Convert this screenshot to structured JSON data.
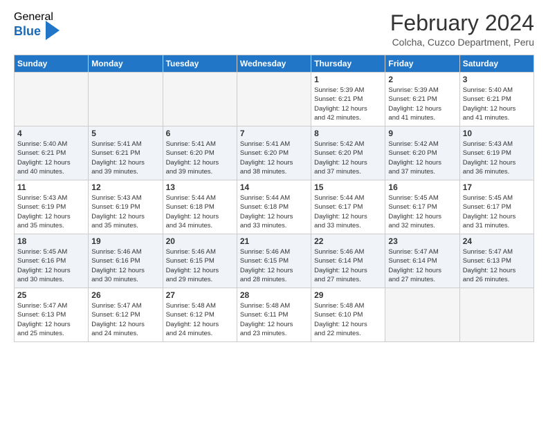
{
  "logo": {
    "general": "General",
    "blue": "Blue"
  },
  "title": "February 2024",
  "subtitle": "Colcha, Cuzco Department, Peru",
  "days_of_week": [
    "Sunday",
    "Monday",
    "Tuesday",
    "Wednesday",
    "Thursday",
    "Friday",
    "Saturday"
  ],
  "weeks": [
    [
      {
        "day": "",
        "info": ""
      },
      {
        "day": "",
        "info": ""
      },
      {
        "day": "",
        "info": ""
      },
      {
        "day": "",
        "info": ""
      },
      {
        "day": "1",
        "info": "Sunrise: 5:39 AM\nSunset: 6:21 PM\nDaylight: 12 hours\nand 42 minutes."
      },
      {
        "day": "2",
        "info": "Sunrise: 5:39 AM\nSunset: 6:21 PM\nDaylight: 12 hours\nand 41 minutes."
      },
      {
        "day": "3",
        "info": "Sunrise: 5:40 AM\nSunset: 6:21 PM\nDaylight: 12 hours\nand 41 minutes."
      }
    ],
    [
      {
        "day": "4",
        "info": "Sunrise: 5:40 AM\nSunset: 6:21 PM\nDaylight: 12 hours\nand 40 minutes."
      },
      {
        "day": "5",
        "info": "Sunrise: 5:41 AM\nSunset: 6:21 PM\nDaylight: 12 hours\nand 39 minutes."
      },
      {
        "day": "6",
        "info": "Sunrise: 5:41 AM\nSunset: 6:20 PM\nDaylight: 12 hours\nand 39 minutes."
      },
      {
        "day": "7",
        "info": "Sunrise: 5:41 AM\nSunset: 6:20 PM\nDaylight: 12 hours\nand 38 minutes."
      },
      {
        "day": "8",
        "info": "Sunrise: 5:42 AM\nSunset: 6:20 PM\nDaylight: 12 hours\nand 37 minutes."
      },
      {
        "day": "9",
        "info": "Sunrise: 5:42 AM\nSunset: 6:20 PM\nDaylight: 12 hours\nand 37 minutes."
      },
      {
        "day": "10",
        "info": "Sunrise: 5:43 AM\nSunset: 6:19 PM\nDaylight: 12 hours\nand 36 minutes."
      }
    ],
    [
      {
        "day": "11",
        "info": "Sunrise: 5:43 AM\nSunset: 6:19 PM\nDaylight: 12 hours\nand 35 minutes."
      },
      {
        "day": "12",
        "info": "Sunrise: 5:43 AM\nSunset: 6:19 PM\nDaylight: 12 hours\nand 35 minutes."
      },
      {
        "day": "13",
        "info": "Sunrise: 5:44 AM\nSunset: 6:18 PM\nDaylight: 12 hours\nand 34 minutes."
      },
      {
        "day": "14",
        "info": "Sunrise: 5:44 AM\nSunset: 6:18 PM\nDaylight: 12 hours\nand 33 minutes."
      },
      {
        "day": "15",
        "info": "Sunrise: 5:44 AM\nSunset: 6:17 PM\nDaylight: 12 hours\nand 33 minutes."
      },
      {
        "day": "16",
        "info": "Sunrise: 5:45 AM\nSunset: 6:17 PM\nDaylight: 12 hours\nand 32 minutes."
      },
      {
        "day": "17",
        "info": "Sunrise: 5:45 AM\nSunset: 6:17 PM\nDaylight: 12 hours\nand 31 minutes."
      }
    ],
    [
      {
        "day": "18",
        "info": "Sunrise: 5:45 AM\nSunset: 6:16 PM\nDaylight: 12 hours\nand 30 minutes."
      },
      {
        "day": "19",
        "info": "Sunrise: 5:46 AM\nSunset: 6:16 PM\nDaylight: 12 hours\nand 30 minutes."
      },
      {
        "day": "20",
        "info": "Sunrise: 5:46 AM\nSunset: 6:15 PM\nDaylight: 12 hours\nand 29 minutes."
      },
      {
        "day": "21",
        "info": "Sunrise: 5:46 AM\nSunset: 6:15 PM\nDaylight: 12 hours\nand 28 minutes."
      },
      {
        "day": "22",
        "info": "Sunrise: 5:46 AM\nSunset: 6:14 PM\nDaylight: 12 hours\nand 27 minutes."
      },
      {
        "day": "23",
        "info": "Sunrise: 5:47 AM\nSunset: 6:14 PM\nDaylight: 12 hours\nand 27 minutes."
      },
      {
        "day": "24",
        "info": "Sunrise: 5:47 AM\nSunset: 6:13 PM\nDaylight: 12 hours\nand 26 minutes."
      }
    ],
    [
      {
        "day": "25",
        "info": "Sunrise: 5:47 AM\nSunset: 6:13 PM\nDaylight: 12 hours\nand 25 minutes."
      },
      {
        "day": "26",
        "info": "Sunrise: 5:47 AM\nSunset: 6:12 PM\nDaylight: 12 hours\nand 24 minutes."
      },
      {
        "day": "27",
        "info": "Sunrise: 5:48 AM\nSunset: 6:12 PM\nDaylight: 12 hours\nand 24 minutes."
      },
      {
        "day": "28",
        "info": "Sunrise: 5:48 AM\nSunset: 6:11 PM\nDaylight: 12 hours\nand 23 minutes."
      },
      {
        "day": "29",
        "info": "Sunrise: 5:48 AM\nSunset: 6:10 PM\nDaylight: 12 hours\nand 22 minutes."
      },
      {
        "day": "",
        "info": ""
      },
      {
        "day": "",
        "info": ""
      }
    ]
  ]
}
